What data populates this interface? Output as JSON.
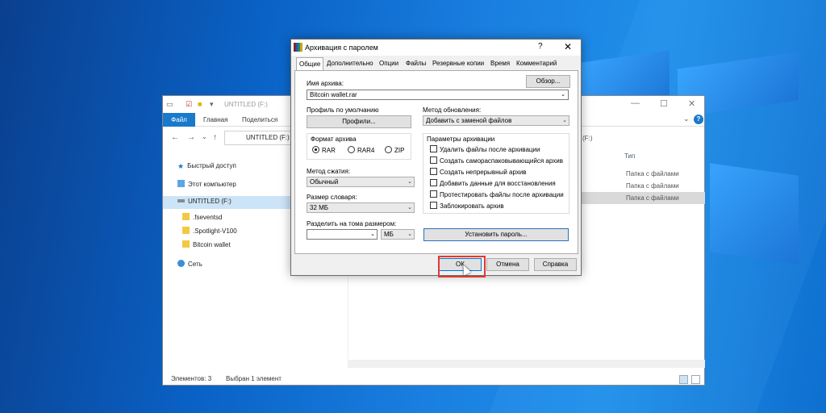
{
  "explorer": {
    "title": "UNTITLED (F:)",
    "ribbon_tabs": [
      "Файл",
      "Главная",
      "Поделиться"
    ],
    "address": "UNTITLED (F:)",
    "address_right": "(F:)",
    "sidebar": {
      "quick_access": "Быстрый доступ",
      "this_pc": "Этот компьютер",
      "drive": "UNTITLED (F:)",
      "items": [
        ".fseventsd",
        ".Spotlight-V100",
        "Bitcoin wallet"
      ],
      "network": "Сеть"
    },
    "column_type": "Тип",
    "type_cells": [
      "Папка с файлами",
      "Папка с файлами",
      "Папка с файлами"
    ],
    "status_items": "Элементов: 3",
    "status_selected": "Выбран 1 элемент"
  },
  "dialog": {
    "title": "Архивация с паролем",
    "help": "?",
    "close": "✕",
    "tabs": [
      "Общие",
      "Дополнительно",
      "Опции",
      "Файлы",
      "Резервные копии",
      "Время",
      "Комментарий"
    ],
    "archive_name_label": "Имя архива:",
    "browse_button": "Обзор...",
    "archive_name_value": "Bitcoin wallet.rar",
    "default_profile_label": "Профиль по умолчанию",
    "profiles_button": "Профили...",
    "update_method_label": "Метод обновления:",
    "update_method_value": "Добавить с заменой файлов",
    "format_label": "Формат архива",
    "formats": [
      "RAR",
      "RAR4",
      "ZIP"
    ],
    "compression_label": "Метод сжатия:",
    "compression_value": "Обычный",
    "dictionary_label": "Размер словаря:",
    "dictionary_value": "32 МБ",
    "split_label": "Разделить на тома размером:",
    "split_unit": "МБ",
    "params_label": "Параметры архивации",
    "params": [
      "Удалить файлы после архивации",
      "Создать самораспаковывающийся архив",
      "Создать непрерывный архив",
      "Добавить данные для восстановления",
      "Протестировать файлы после архивации",
      "Заблокировать архив"
    ],
    "set_password_button": "Установить пароль...",
    "ok_button": "ОК",
    "cancel_button": "Отмена",
    "help_button": "Справка"
  }
}
